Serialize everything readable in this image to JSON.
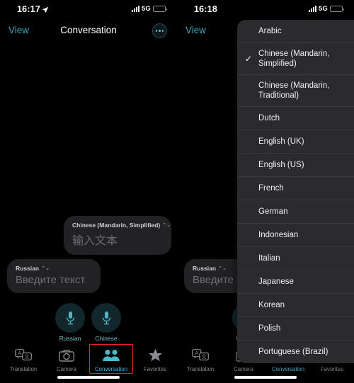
{
  "left_panel": {
    "status_bar": {
      "time": "16:17",
      "location_icon": "location-arrow-icon",
      "signal_icon": "cellular-bars-icon",
      "network": "5G",
      "battery_icon": "battery-icon"
    },
    "nav": {
      "back_label": "View",
      "title": "Conversation",
      "more_icon": "ellipsis-circle-icon"
    },
    "bubbles": [
      {
        "lang": "Chinese (Mandarin, Simplified)",
        "chevron": "⌃⌄",
        "placeholder": "输入文本"
      },
      {
        "lang": "Russian",
        "chevron": "⌃⌄",
        "placeholder": "Введите текст"
      }
    ],
    "mics": [
      {
        "icon": "microphone-icon",
        "label": "Russian"
      },
      {
        "icon": "microphone-icon",
        "label": "Chinese"
      }
    ],
    "tabs": [
      {
        "label": "Translation",
        "icon": "translation-icon",
        "active": false
      },
      {
        "label": "Camera",
        "icon": "camera-icon",
        "active": false
      },
      {
        "label": "Conversation",
        "icon": "conversation-people-icon",
        "active": true
      },
      {
        "label": "Favorites",
        "icon": "star-icon",
        "active": false
      }
    ],
    "highlight_color": "#e8252c"
  },
  "right_panel": {
    "status_bar": {
      "time": "16:18",
      "signal_icon": "cellular-bars-icon",
      "network": "5G",
      "battery_icon": "battery-icon"
    },
    "nav": {
      "back_label": "View"
    },
    "bubbles": [
      {
        "lang": "Russian",
        "chevron": "⌃⌄",
        "placeholder": "Введите текст"
      }
    ],
    "mics": [
      {
        "icon": "microphone-collapsed-icon",
        "label": "Russian"
      },
      {
        "icon": "microphone-collapsed-icon",
        "label": "Chinese"
      }
    ],
    "tabs": [
      {
        "label": "Translation",
        "icon": "translation-icon",
        "active": false
      },
      {
        "label": "Camera",
        "icon": "camera-icon",
        "active": false
      },
      {
        "label": "Conversation",
        "icon": "conversation-people-icon",
        "active": true
      },
      {
        "label": "Favorites",
        "icon": "star-icon",
        "active": false
      }
    ]
  },
  "language_dropdown": {
    "selected": "Chinese (Mandarin, Simplified)",
    "check_icon": "checkmark-icon",
    "items": [
      {
        "label": "Arabic",
        "selected": false
      },
      {
        "label": "Chinese (Mandarin, Simplified)",
        "selected": true
      },
      {
        "label": "Chinese (Mandarin, Traditional)",
        "selected": false
      },
      {
        "label": "Dutch",
        "selected": false
      },
      {
        "label": "English (UK)",
        "selected": false
      },
      {
        "label": "English (US)",
        "selected": false
      },
      {
        "label": "French",
        "selected": false
      },
      {
        "label": "German",
        "selected": false
      },
      {
        "label": "Indonesian",
        "selected": false
      },
      {
        "label": "Italian",
        "selected": false
      },
      {
        "label": "Japanese",
        "selected": false
      },
      {
        "label": "Korean",
        "selected": false
      },
      {
        "label": "Polish",
        "selected": false
      },
      {
        "label": "Portuguese (Brazil)",
        "selected": false
      }
    ]
  },
  "colors": {
    "accent": "#4fb6cc",
    "highlight": "#e8252c",
    "bubble": "#222225",
    "dropdown": "#2b2b2d"
  }
}
